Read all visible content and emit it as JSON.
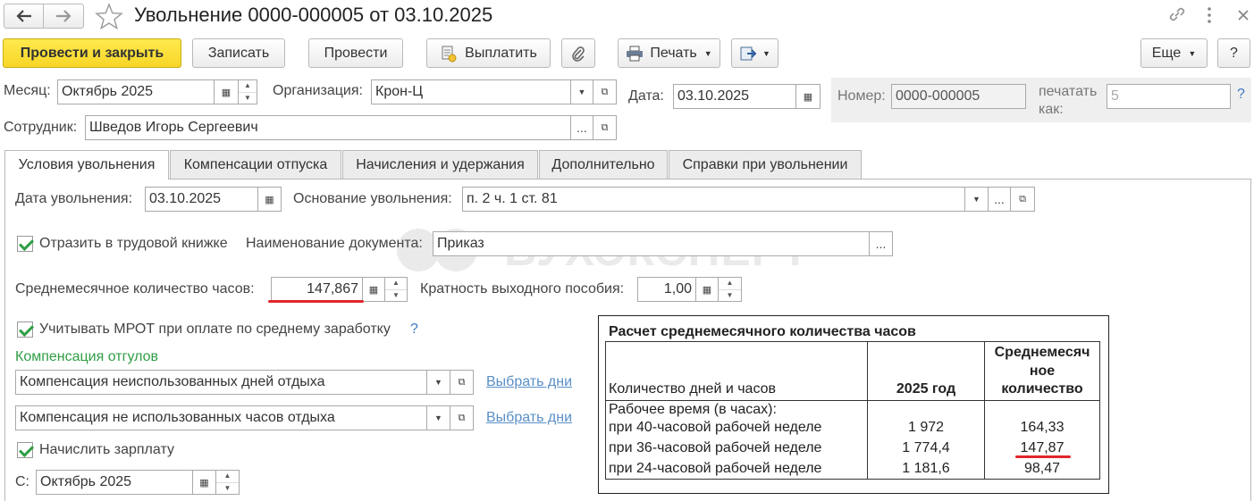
{
  "window": {
    "title": "Увольнение 0000-000005 от 03.10.2025"
  },
  "toolbar": {
    "post_close": "Провести и закрыть",
    "save": "Записать",
    "post": "Провести",
    "pay": "Выплатить",
    "print": "Печать",
    "more": "Еще",
    "help": "?"
  },
  "header": {
    "month_label": "Месяц:",
    "month_value": "Октябрь 2025",
    "org_label": "Организация:",
    "org_value": "Крон-Ц",
    "date_label": "Дата:",
    "date_value": "03.10.2025",
    "number_label": "Номер:",
    "number_value": "0000-000005",
    "print_as_label_1": "печатать",
    "print_as_label_2": "как:",
    "print_as_placeholder": "5",
    "help_q": "?",
    "employee_label": "Сотрудник:",
    "employee_value": "Шведов Игорь Сергеевич"
  },
  "tabs": [
    {
      "label": "Условия увольнения"
    },
    {
      "label": "Компенсации отпуска"
    },
    {
      "label": "Начисления и удержания"
    },
    {
      "label": "Дополнительно"
    },
    {
      "label": "Справки при увольнении"
    }
  ],
  "form": {
    "dismissal_date_label": "Дата увольнения:",
    "dismissal_date_value": "03.10.2025",
    "reason_label": "Основание увольнения:",
    "reason_value": "п. 2 ч. 1 ст. 81",
    "reflect_label": "Отразить в трудовой книжке",
    "doc_name_label": "Наименование документа:",
    "doc_name_value": "Приказ",
    "avg_hours_label": "Среднемесячное количество часов:",
    "avg_hours_value": "147,867",
    "severance_label": "Кратность выходного пособия:",
    "severance_value": "1,00",
    "mrot_label": "Учитывать МРОТ при оплате по среднему заработку",
    "mrot_help": "?",
    "comp_section": "Компенсация отгулов",
    "comp_days_value": "Компенсация неиспользованных дней отдыха",
    "comp_hours_value": "Компенсация не использованных часов отдыха",
    "choose_days_1": "Выбрать дни",
    "choose_days_2": "Выбрать дни",
    "salary_label": "Начислить зарплату",
    "from_label": "С:",
    "from_value": "Октябрь 2025"
  },
  "watermark": "БУХЭКСПЕРТ",
  "calc_table": {
    "title": "Расчет среднемесячного количества часов",
    "col1": "Количество дней и часов",
    "col2": "2025 год",
    "col3_line1": "Среднемесяч",
    "col3_line2": "ное",
    "col3_line3": "количество",
    "row_header": "Рабочее время (в часах):",
    "rows": [
      {
        "label": "при 40-часовой рабочей неделе",
        "year": "1 972",
        "avg": "164,33"
      },
      {
        "label": "при 36-часовой рабочей неделе",
        "year": "1 774,4",
        "avg": "147,87"
      },
      {
        "label": "при 24-часовой рабочей неделе",
        "year": "1 181,6",
        "avg": "98,47"
      }
    ]
  },
  "colors": {
    "accent_yellow": "#f7d628",
    "underline_red": "#e0262b",
    "link_blue": "#5a8fc7",
    "section_green": "#2f9e44"
  }
}
